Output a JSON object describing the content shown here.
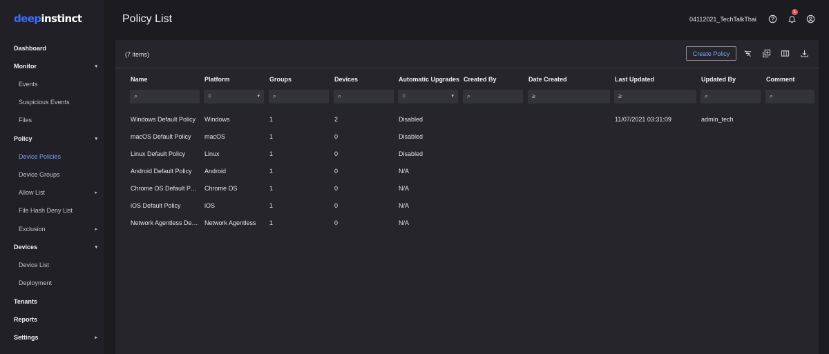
{
  "logo": {
    "part1": "deep",
    "part2": "instinct"
  },
  "sidebar": {
    "items": [
      {
        "label": "Dashboard",
        "level": "top",
        "chevron": ""
      },
      {
        "label": "Monitor",
        "level": "top",
        "chevron": "▾"
      },
      {
        "label": "Events",
        "level": "sub",
        "chevron": ""
      },
      {
        "label": "Suspicious Events",
        "level": "sub",
        "chevron": ""
      },
      {
        "label": "Files",
        "level": "sub",
        "chevron": ""
      },
      {
        "label": "Policy",
        "level": "top",
        "chevron": "▾"
      },
      {
        "label": "Device Policies",
        "level": "sub",
        "chevron": "",
        "active": true
      },
      {
        "label": "Device Groups",
        "level": "sub",
        "chevron": ""
      },
      {
        "label": "Allow List",
        "level": "sub",
        "chevron": "▸"
      },
      {
        "label": "File Hash Deny List",
        "level": "sub",
        "chevron": ""
      },
      {
        "label": "Exclusion",
        "level": "sub",
        "chevron": "▸"
      },
      {
        "label": "Devices",
        "level": "top",
        "chevron": "▾"
      },
      {
        "label": "Device List",
        "level": "sub",
        "chevron": ""
      },
      {
        "label": "Deployment",
        "level": "sub",
        "chevron": ""
      },
      {
        "label": "Tenants",
        "level": "top",
        "chevron": ""
      },
      {
        "label": "Reports",
        "level": "top",
        "chevron": ""
      },
      {
        "label": "Settings",
        "level": "top",
        "chevron": "▸"
      }
    ]
  },
  "header": {
    "title": "Policy List",
    "username": "04112021_TechTalkThai",
    "notification_count": "1",
    "icons": [
      "help-icon",
      "bell-icon",
      "account-icon"
    ]
  },
  "toolbar": {
    "items_count": "(7 items)",
    "create_label": "Create Policy",
    "icons": [
      "clear-filter-icon",
      "copy-icon",
      "columns-icon",
      "download-icon"
    ]
  },
  "table": {
    "columns": [
      "Name",
      "Platform",
      "Groups",
      "Devices",
      "Automatic Upgrades",
      "Created By",
      "Date Created",
      "Last Updated",
      "Updated By",
      "Comment"
    ],
    "filter_symbols": [
      "⌕",
      "=",
      "⌕",
      "⌕",
      "=",
      "⌕",
      "≥",
      "≥",
      "⌕",
      "⌕"
    ],
    "rows": [
      [
        "Windows Default Policy",
        "Windows",
        "1",
        "2",
        "Disabled",
        "",
        "",
        "11/07/2021 03:31:09",
        "admin_tech",
        ""
      ],
      [
        "macOS Default Policy",
        "macOS",
        "1",
        "0",
        "Disabled",
        "",
        "",
        "",
        "",
        ""
      ],
      [
        "Linux Default Policy",
        "Linux",
        "1",
        "0",
        "Disabled",
        "",
        "",
        "",
        "",
        ""
      ],
      [
        "Android Default Policy",
        "Android",
        "1",
        "0",
        "N/A",
        "",
        "",
        "",
        "",
        ""
      ],
      [
        "Chrome OS Default Policy",
        "Chrome OS",
        "1",
        "0",
        "N/A",
        "",
        "",
        "",
        "",
        ""
      ],
      [
        "iOS Default Policy",
        "iOS",
        "1",
        "0",
        "N/A",
        "",
        "",
        "",
        "",
        ""
      ],
      [
        "Network Agentless Default Policy",
        "Network Agentless",
        "1",
        "0",
        "N/A",
        "",
        "",
        "",
        "",
        ""
      ]
    ]
  },
  "colors": {
    "accent": "#7aa0f2",
    "brand_blue": "#3f6bff",
    "badge": "#e05a5a"
  }
}
